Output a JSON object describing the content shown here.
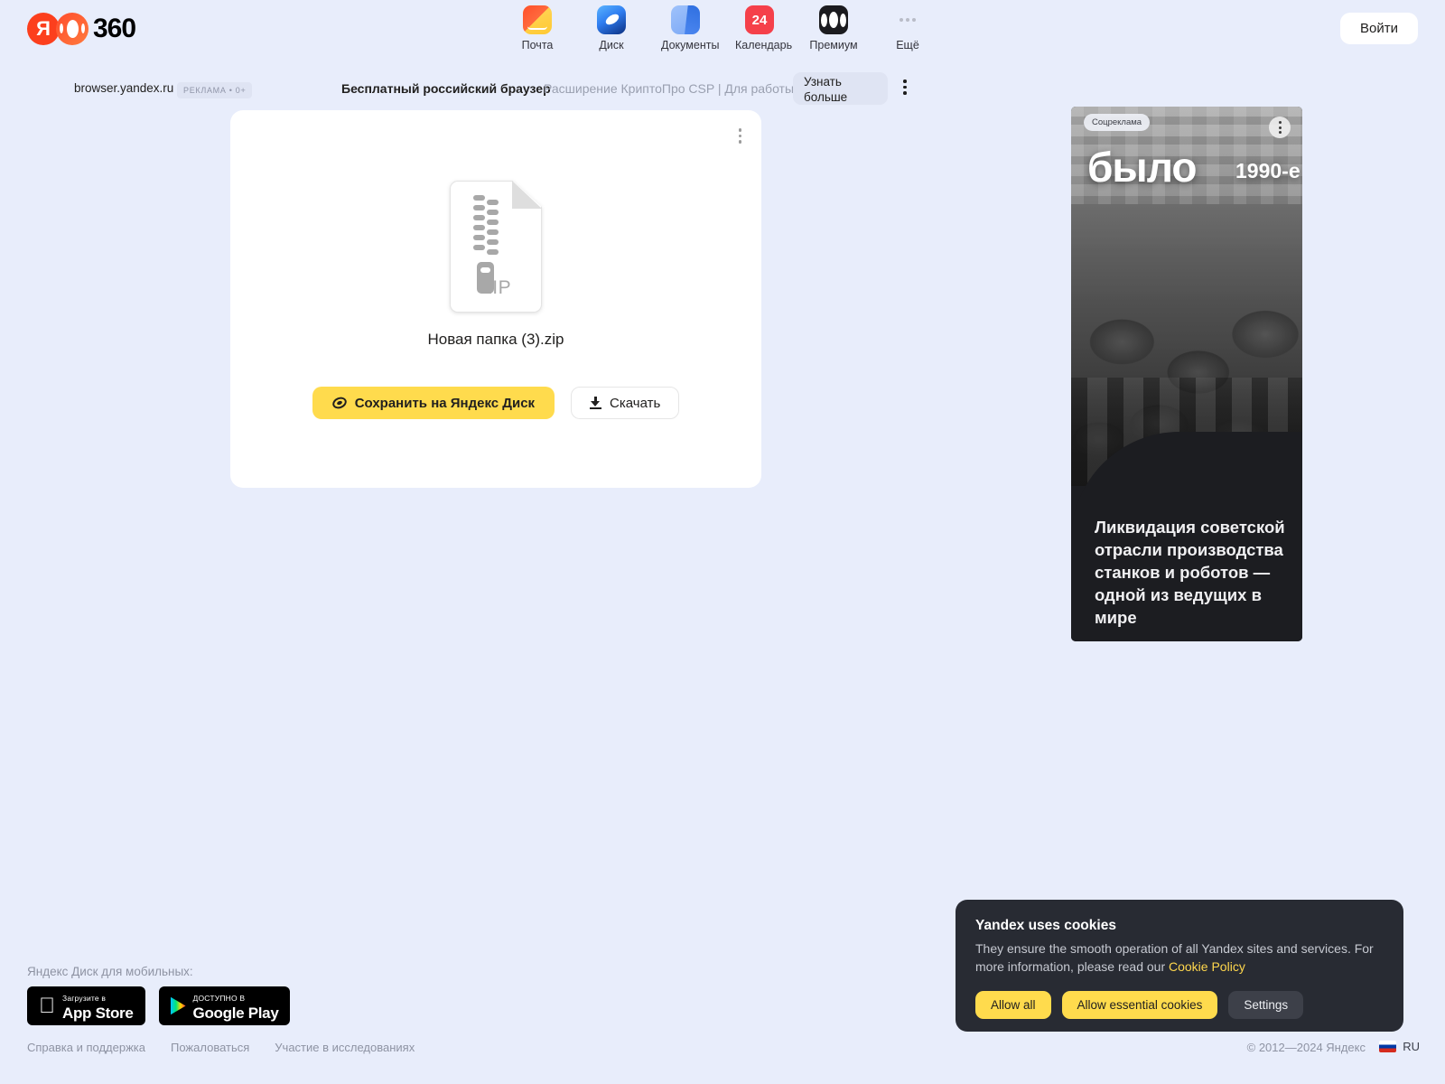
{
  "header": {
    "logo": {
      "ya": "Я",
      "text": "360"
    },
    "nav": [
      {
        "label": "Почта",
        "icon": "mail-icon"
      },
      {
        "label": "Диск",
        "icon": "disk-icon"
      },
      {
        "label": "Документы",
        "icon": "documents-icon"
      },
      {
        "label": "Календарь",
        "icon": "calendar-icon",
        "badge": "24"
      },
      {
        "label": "Премиум",
        "icon": "premium-icon"
      },
      {
        "label": "Ещё",
        "icon": "more-dots-icon"
      }
    ],
    "login_label": "Войти"
  },
  "ad_strip": {
    "domain": "browser.yandex.ru",
    "badge": "РЕКЛАМА • 0+",
    "title": "Бесплатный российский браузер",
    "subtitle": "Расширение КриптоПро CSP | Для работы с",
    "cta": "Узнать больше"
  },
  "file_card": {
    "file_type_label": "ZIP",
    "file_name": "Новая папка (3).zip",
    "save_label": "Сохранить на Яндекс Диск",
    "download_label": "Скачать"
  },
  "social_banner": {
    "tag": "Соцреклама",
    "headline": "было",
    "year": "1990-е",
    "body": "Ликвидация советской отрасли производства станков и роботов — одной из ведущих в мире"
  },
  "cookie": {
    "title": "Yandex uses cookies",
    "text": "They ensure the smooth operation of all Yandex sites and services. For more information, please read our ",
    "link": "Cookie Policy",
    "allow_all": "Allow all",
    "allow_essential": "Allow essential cookies",
    "settings": "Settings"
  },
  "footer": {
    "mobile_label": "Яндекс Диск для мобильных:",
    "appstore": {
      "small": "Загрузите в",
      "big": "App Store"
    },
    "googleplay": {
      "small": "ДОСТУПНО В",
      "big": "Google Play"
    },
    "links": [
      {
        "label": "Справка и поддержка"
      },
      {
        "label": "Пожаловаться"
      },
      {
        "label": "Участие в исследованиях"
      }
    ],
    "copyright": "© 2012—2024 Яндекс",
    "lang": "RU"
  },
  "colors": {
    "background": "#e8edfb",
    "accent_yellow": "#ffdb4d",
    "brand_red": "#fc3f1d",
    "dark_panel": "#282b33"
  }
}
